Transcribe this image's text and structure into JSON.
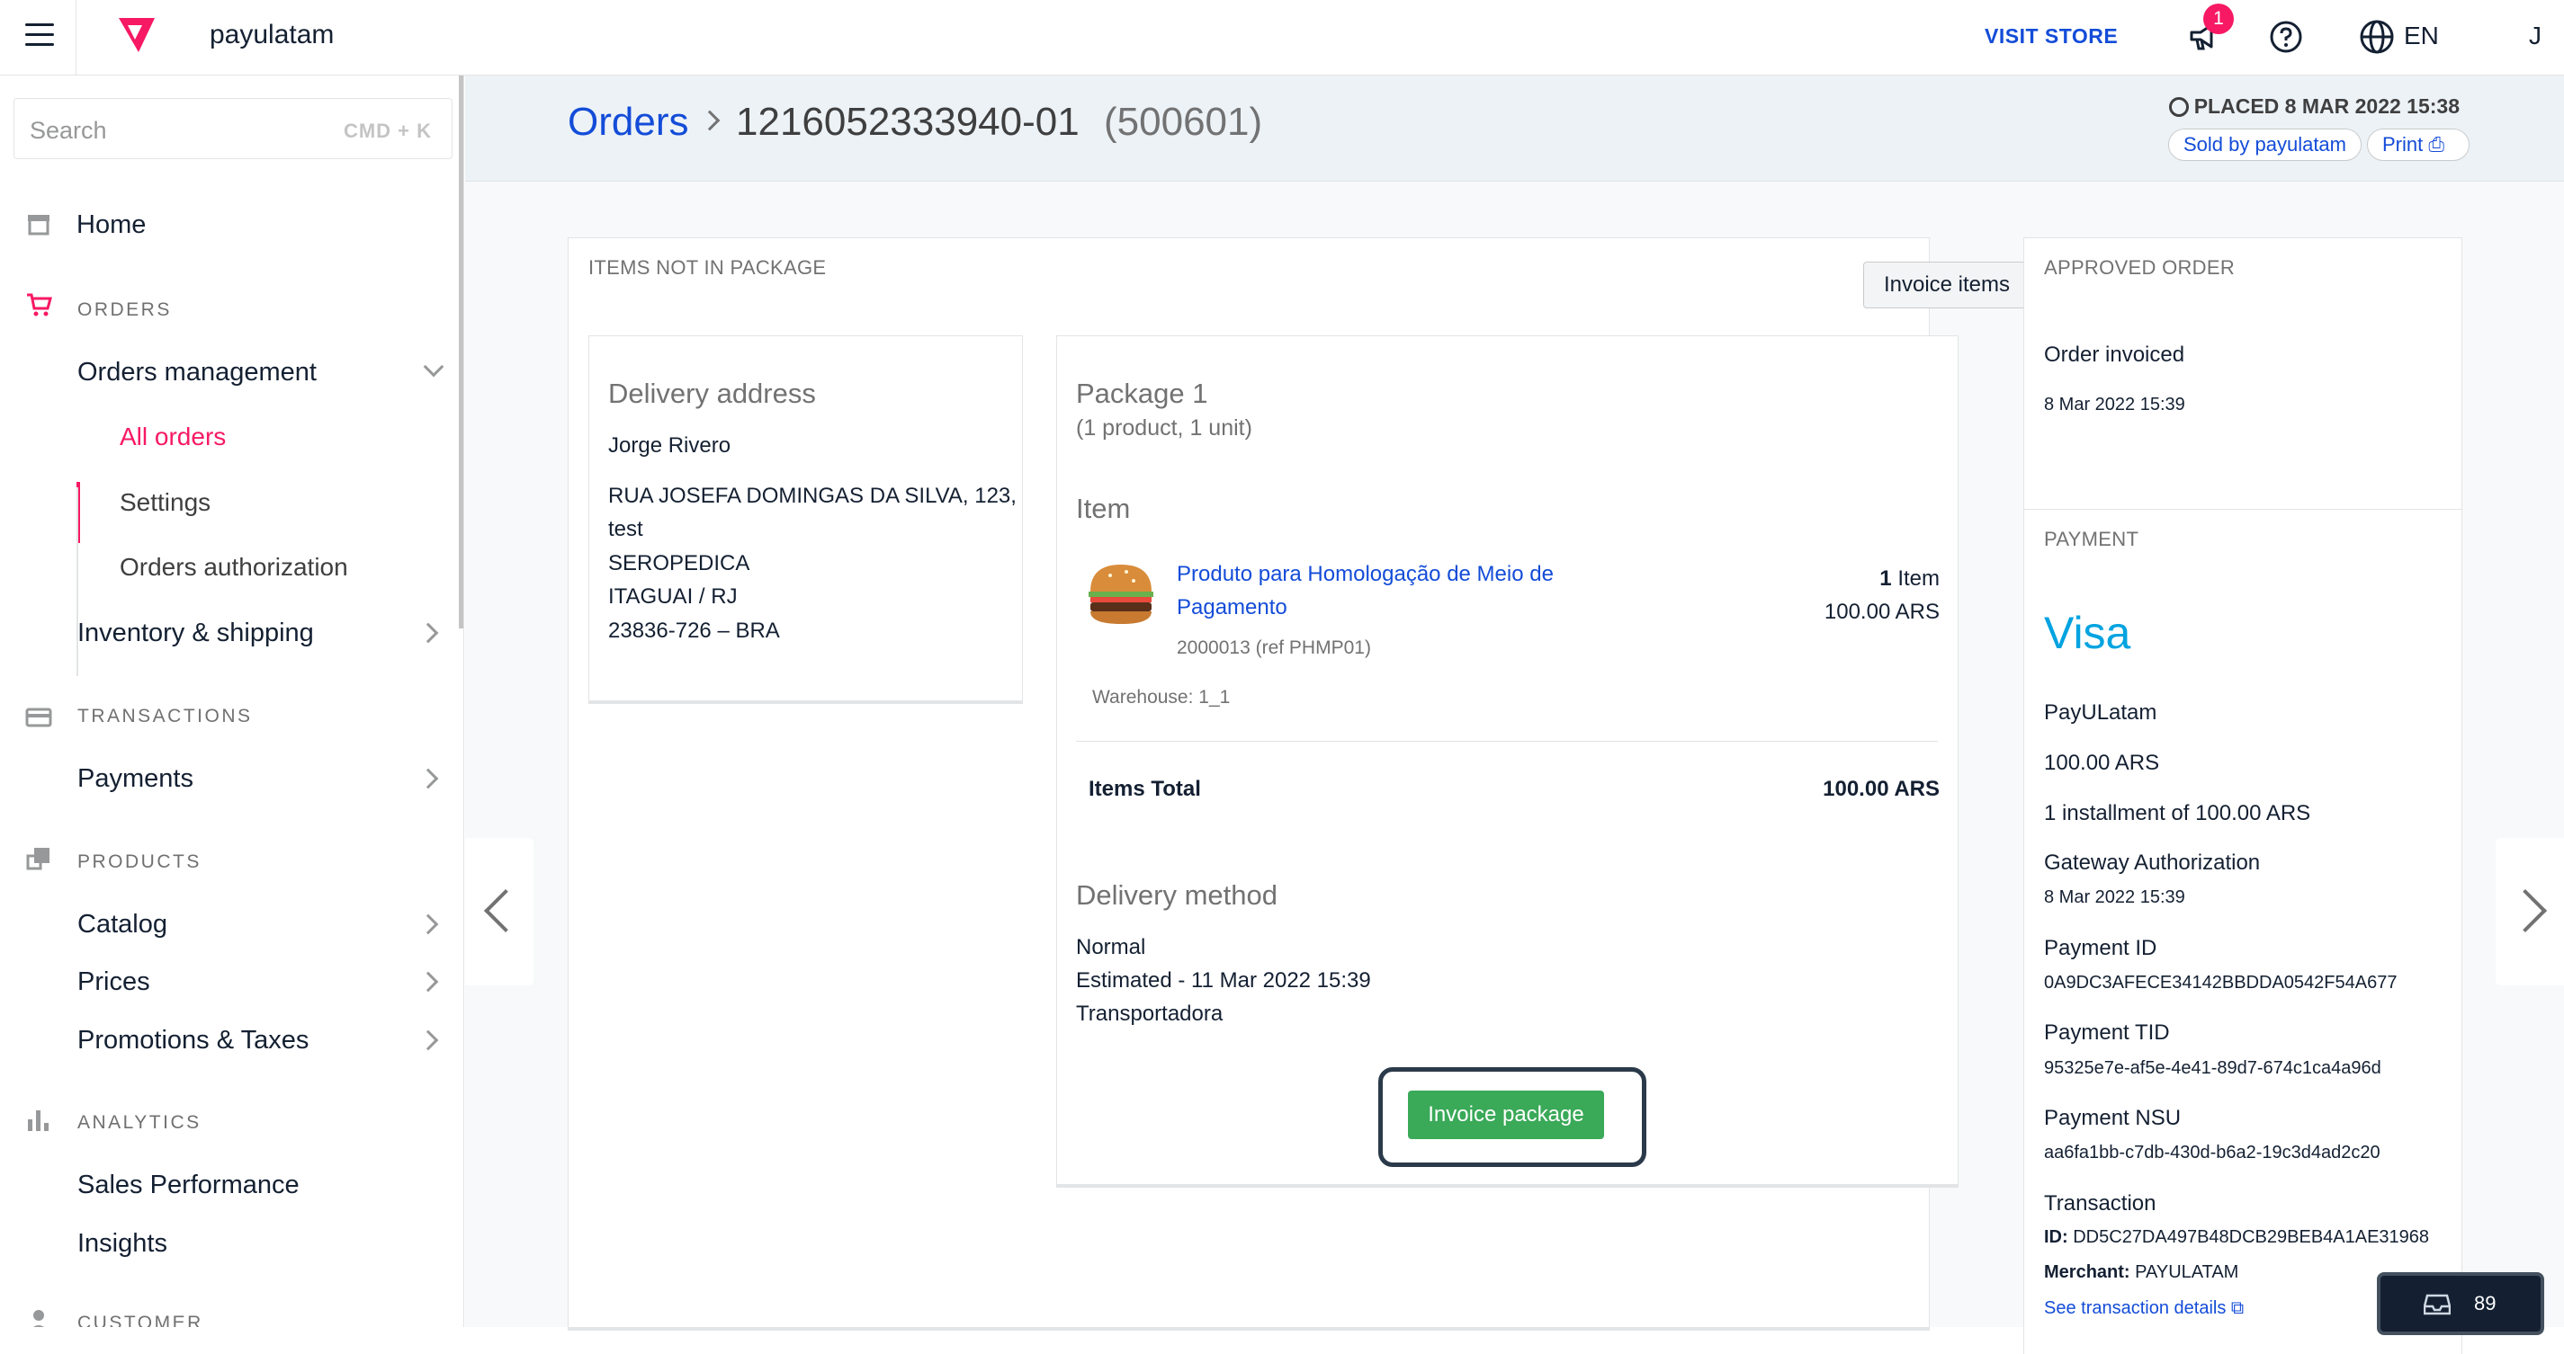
{
  "topbar": {
    "account_name": "payulatam",
    "visit_store": "VISIT STORE",
    "notification_count": "1",
    "language": "EN",
    "user_initial": "J",
    "brand_color": "#f71963"
  },
  "sidebar": {
    "search_placeholder": "Search",
    "search_shortcut": "CMD + K",
    "home": "Home",
    "orders_section": "ORDERS",
    "orders_management": "Orders management",
    "all_orders": "All orders",
    "settings": "Settings",
    "orders_authorization": "Orders authorization",
    "inventory_shipping": "Inventory & shipping",
    "transactions_section": "TRANSACTIONS",
    "payments": "Payments",
    "products_section": "PRODUCTS",
    "catalog": "Catalog",
    "prices": "Prices",
    "promotions_taxes": "Promotions & Taxes",
    "analytics_section": "ANALYTICS",
    "sales_performance": "Sales Performance",
    "insights": "Insights",
    "customer_section": "CUSTOMER"
  },
  "header": {
    "breadcrumb_orders": "Orders",
    "order_id": "1216052333940-01",
    "order_sequence": "(500601)",
    "placed": "PLACED 8 MAR 2022 15:38",
    "sold_by": "Sold by payulatam",
    "print": "Print"
  },
  "items_card": {
    "title": "ITEMS NOT IN PACKAGE",
    "invoice_items": "Invoice items",
    "delivery": {
      "title": "Delivery address",
      "name": "Jorge Rivero",
      "street_line1": "RUA JOSEFA DOMINGAS DA SILVA, 123,",
      "street_line2": "test",
      "district": "SEROPEDICA",
      "city_state": "ITAGUAI / RJ",
      "postal_country": "23836-726 – BRA"
    },
    "package": {
      "title": "Package 1",
      "summary": "(1 product, 1 unit)",
      "item_header": "Item",
      "product_name_line1": "Produto para Homologação de Meio de",
      "product_name_line2": "Pagamento",
      "product_ref": "2000013 (ref PHMP01)",
      "quantity": "1",
      "quantity_unit": "Item",
      "price": "100.00 ARS",
      "warehouse": "Warehouse: 1_1",
      "items_total_label": "Items Total",
      "items_total_value": "100.00 ARS",
      "delivery_method_title": "Delivery method",
      "delivery_type": "Normal",
      "estimated": "Estimated - 11 Mar 2022 15:39",
      "carrier": "Transportadora",
      "invoice_package": "Invoice package"
    }
  },
  "status_card": {
    "title": "APPROVED ORDER",
    "status": "Order invoiced",
    "date": "8 Mar 2022 15:39"
  },
  "payment_card": {
    "title": "PAYMENT",
    "brand": "Visa",
    "gateway": "PayULatam",
    "amount": "100.00 ARS",
    "installments": "1 installment of 100.00 ARS",
    "gateway_auth_label": "Gateway Authorization",
    "gateway_auth_date": "8 Mar 2022 15:39",
    "payment_id_label": "Payment ID",
    "payment_id": "0A9DC3AFECE34142BBDDA0542F54A677",
    "payment_tid_label": "Payment TID",
    "payment_tid": "95325e7e-af5e-4e41-89d7-674c1ca4a96d",
    "payment_nsu_label": "Payment NSU",
    "payment_nsu": "aa6fa1bb-c7db-430d-b6a2-19c3d4ad2c20",
    "transaction_label": "Transaction",
    "transaction_id_label": "ID:",
    "transaction_id": "DD5C27DA497B48DCB29BEB4A1AE31968",
    "merchant_label": "Merchant:",
    "merchant": "PAYULATAM",
    "see_details": "See transaction details"
  },
  "taskbar": {
    "count": "89"
  }
}
